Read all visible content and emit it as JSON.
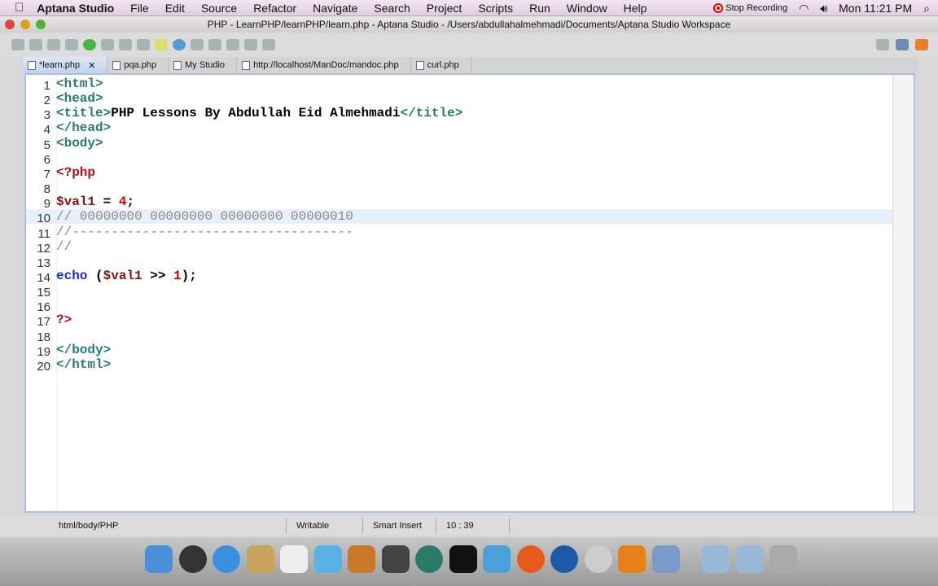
{
  "menubar": {
    "app": "Aptana Studio",
    "items": [
      "File",
      "Edit",
      "Source",
      "Refactor",
      "Navigate",
      "Search",
      "Project",
      "Scripts",
      "Run",
      "Window",
      "Help"
    ],
    "recording": "Stop Recording",
    "clock": "Mon 11:21 PM"
  },
  "window": {
    "title": "PHP - LearnPHP/learnPHP/learn.php - Aptana Studio - /Users/abdullahalmehmadi/Documents/Aptana Studio Workspace"
  },
  "tabs": [
    {
      "label": "*learn.php",
      "active": true
    },
    {
      "label": "pqa.php"
    },
    {
      "label": "My Studio"
    },
    {
      "label": "http://localhost/ManDoc/mandoc.php"
    },
    {
      "label": "curl.php"
    }
  ],
  "editor": {
    "current_line": 10,
    "lines": [
      [
        [
          "tag",
          "<html>"
        ]
      ],
      [
        [
          "tag",
          "<head>"
        ]
      ],
      [
        [
          "tag",
          "<title>"
        ],
        [
          "txt",
          "PHP Lessons By Abdullah Eid Almehmadi"
        ],
        [
          "tag",
          "</title>"
        ]
      ],
      [
        [
          "tag",
          "</head>"
        ]
      ],
      [
        [
          "tag",
          "<body>"
        ]
      ],
      [],
      [
        [
          "php",
          "<?php"
        ]
      ],
      [],
      [
        [
          "var",
          "$val1"
        ],
        [
          "txt",
          " = "
        ],
        [
          "num",
          "4"
        ],
        [
          "txt",
          ";"
        ]
      ],
      [
        [
          "cm",
          "// 00000000 00000000 00000000 00000010"
        ]
      ],
      [
        [
          "cm",
          "//------------------------------------"
        ]
      ],
      [
        [
          "cm",
          "//"
        ]
      ],
      [],
      [
        [
          "kw",
          "echo"
        ],
        [
          "txt",
          " ("
        ],
        [
          "var",
          "$val1"
        ],
        [
          "txt",
          " >> "
        ],
        [
          "num",
          "1"
        ],
        [
          "txt",
          ");"
        ]
      ],
      [],
      [],
      [
        [
          "php",
          "?>"
        ]
      ],
      [],
      [
        [
          "tag",
          "</body>"
        ]
      ],
      [
        [
          "tag",
          "</html>"
        ]
      ]
    ]
  },
  "status": {
    "path": "html/body/PHP",
    "mode": "Writable",
    "insert": "Smart Insert",
    "position": "10 : 39"
  },
  "dock": [
    "finder",
    "dashboard",
    "safari",
    "address-book",
    "ical",
    "itunes",
    "iphoto",
    "imovie",
    "time-machine",
    "zoin",
    "messenger",
    "firefox",
    "quicktime",
    "skype",
    "settings",
    "preview",
    "applications-folder",
    "documents-folder",
    "trash"
  ]
}
